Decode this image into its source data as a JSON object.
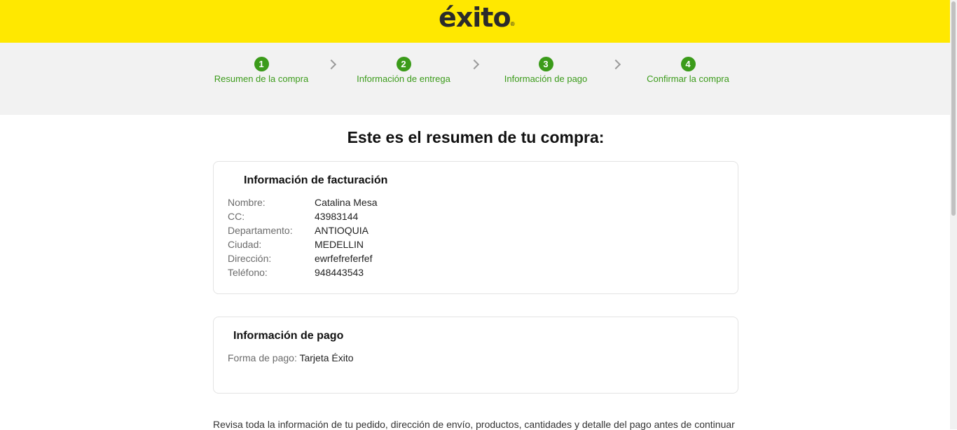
{
  "header": {
    "brand": "éxito",
    "reg_mark": "®",
    "accent_color": "#ffe800"
  },
  "stepper": {
    "steps": [
      {
        "number": "1",
        "label": "Resumen de la compra"
      },
      {
        "number": "2",
        "label": "Información de entrega"
      },
      {
        "number": "3",
        "label": "Información de pago"
      },
      {
        "number": "4",
        "label": "Confirmar la compra"
      }
    ],
    "step_color": "#3b9b1a"
  },
  "main": {
    "title": "Este es el resumen de tu compra:"
  },
  "billing": {
    "heading": "Información de facturación",
    "fields": [
      {
        "label": "Nombre:",
        "value": "Catalina Mesa"
      },
      {
        "label": "CC:",
        "value": "43983144"
      },
      {
        "label": "Departamento:",
        "value": "ANTIOQUIA"
      },
      {
        "label": "Ciudad:",
        "value": "MEDELLIN"
      },
      {
        "label": "Dirección:",
        "value": "ewrfefreferfef"
      },
      {
        "label": "Teléfono:",
        "value": "948443543"
      }
    ]
  },
  "payment": {
    "heading": "Información de pago",
    "method_label": "Forma de pago:",
    "method_value": "Tarjeta Éxito"
  },
  "footer": {
    "notice": "Revisa toda la información de tu pedido, dirección de envío, productos, cantidades y detalle del pago antes de continuar"
  }
}
